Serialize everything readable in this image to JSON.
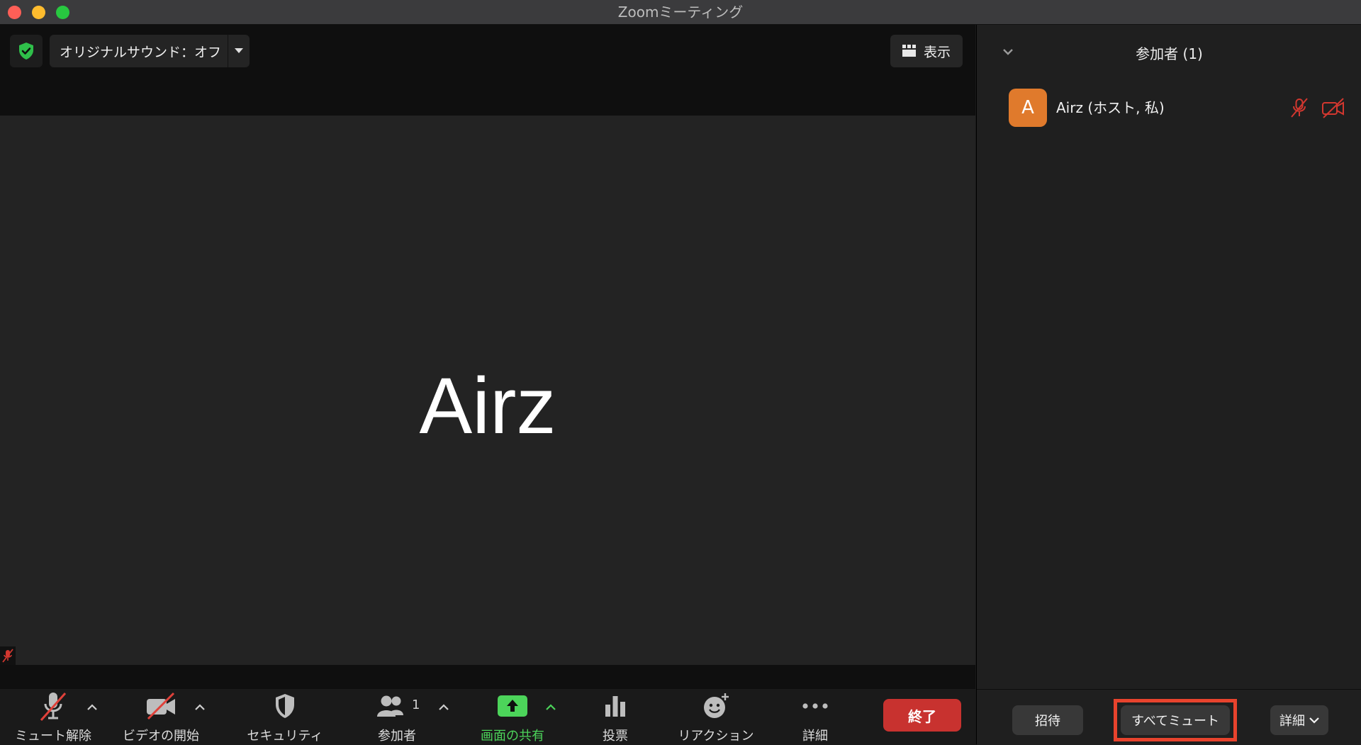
{
  "window": {
    "title": "Zoomミーティング"
  },
  "meeting": {
    "original_sound_label": "オリジナルサウンド：オフ",
    "view_label": "表示",
    "speaker_name": "Airz",
    "shield_color": "#2fbf4a"
  },
  "toolbar": {
    "unmute_label": "ミュート解除",
    "start_video_label": "ビデオの開始",
    "security_label": "セキュリティ",
    "participants_label": "参加者",
    "participants_count": "1",
    "share_screen_label": "画面の共有",
    "polling_label": "投票",
    "reactions_label": "リアクション",
    "more_label": "詳細",
    "end_label": "終了",
    "share_color": "#4cd45a",
    "end_color": "#c8322f"
  },
  "panel": {
    "title": "参加者 (1)",
    "participants": [
      {
        "initial": "A",
        "name": "Airz (ホスト, 私)",
        "avatar_color": "#e07a2c",
        "muted": true,
        "video_off": true
      }
    ],
    "invite_label": "招待",
    "mute_all_label": "すべてミュート",
    "more_label": "詳細",
    "highlight_color": "#e8432d"
  }
}
